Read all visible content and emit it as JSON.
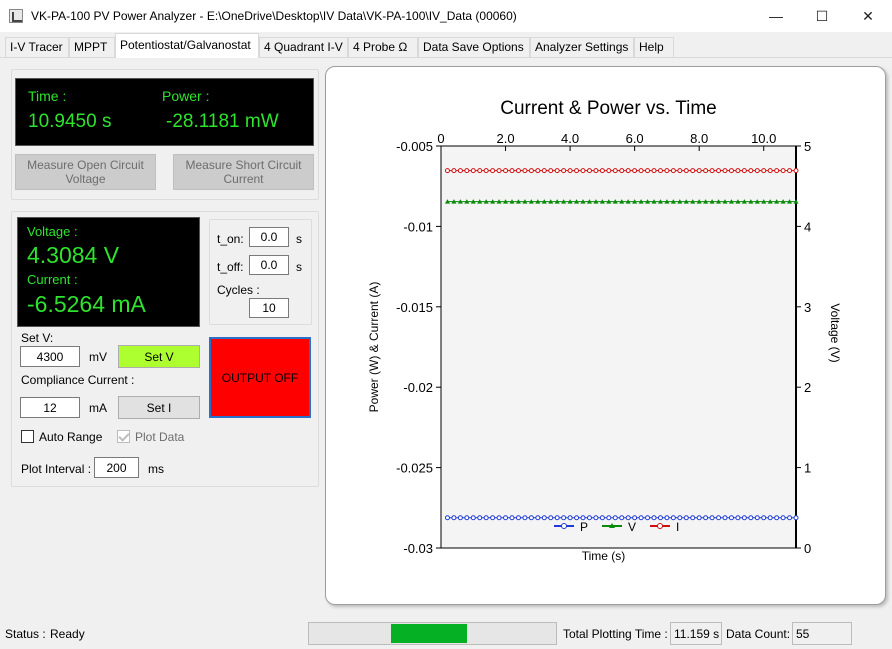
{
  "window": {
    "title": "VK-PA-100 PV Power Analyzer - E:\\OneDrive\\Desktop\\IV Data\\VK-PA-100\\IV_Data (00060)",
    "minimize_glyph": "—",
    "maximize_glyph": "☐",
    "close_glyph": "✕"
  },
  "tabs": [
    {
      "label": "I-V Tracer"
    },
    {
      "label": "MPPT"
    },
    {
      "label": "Potentiostat/Galvanostat"
    },
    {
      "label": "4 Quadrant I-V"
    },
    {
      "label": "4 Probe Ω"
    },
    {
      "label": "Data Save Options"
    },
    {
      "label": "Analyzer Settings"
    },
    {
      "label": "Help"
    }
  ],
  "readout": {
    "time_label": "Time :",
    "time_value": "10.9450 s",
    "power_label": "Power :",
    "power_value": "-28.1181 mW"
  },
  "buttons": {
    "measure_voc": "Measure Open Circuit Voltage",
    "measure_isc": "Measure Short Circuit Current",
    "set_v": "Set V",
    "set_i": "Set I",
    "output": "OUTPUT OFF"
  },
  "meter": {
    "voltage_label": "Voltage :",
    "voltage_value": "4.3084 V",
    "current_label": "Current :",
    "current_value": "-6.5264 mA"
  },
  "pulse": {
    "t_on_label": "t_on:",
    "t_on_value": "0.0",
    "t_on_unit": "s",
    "t_off_label": "t_off:",
    "t_off_value": "0.0",
    "t_off_unit": "s",
    "cycles_label": "Cycles :",
    "cycles_value": "10"
  },
  "setpoint": {
    "set_v_label": "Set V:",
    "set_v_value": "4300",
    "set_v_unit": "mV",
    "compliance_label": "Compliance Current :",
    "compliance_value": "12",
    "compliance_unit": "mA",
    "auto_range_label": "Auto Range",
    "auto_range_checked": false,
    "plot_data_label": "Plot Data",
    "plot_data_checked": true,
    "plot_interval_label": "Plot Interval :",
    "plot_interval_value": "200",
    "plot_interval_unit": "ms"
  },
  "status": {
    "status_label": "Status :",
    "status_value": "Ready",
    "progress_fraction": 0.51,
    "total_time_label": "Total Plotting Time :",
    "total_time_value": "11.159 s",
    "data_count_label": "Data Count:",
    "data_count_value": "55"
  },
  "colors": {
    "lcd_green": "#2ee32e",
    "set_v_button": "#adff2f",
    "output_off": "#ff0000",
    "progress": "#06b025",
    "series_p": "#1f3bd4",
    "series_v": "#0a8a0a",
    "series_i": "#d01010"
  },
  "chart_data": {
    "type": "line",
    "title": "Current & Power vs. Time",
    "xlabel": "Time (s)",
    "ylabel": "Power (W) & Current (A)",
    "y2label": "Voltage (V)",
    "xlim": [
      0,
      11
    ],
    "xticks": [
      "0",
      "2.0",
      "4.0",
      "6.0",
      "8.0",
      "10.0"
    ],
    "xtick_values": [
      0,
      2,
      4,
      6,
      8,
      10
    ],
    "ylim": [
      -0.03,
      -0.005
    ],
    "yticks": [
      "-0.005",
      "-0.01",
      "-0.015",
      "-0.02",
      "-0.025",
      "-0.03"
    ],
    "ytick_values": [
      -0.005,
      -0.01,
      -0.015,
      -0.02,
      -0.025,
      -0.03
    ],
    "y2lim": [
      0,
      5
    ],
    "y2ticks": [
      "5",
      "4",
      "3",
      "2",
      "1",
      "0"
    ],
    "y2tick_values": [
      5,
      4,
      3,
      2,
      1,
      0
    ],
    "x_axis_position": "top",
    "grid": false,
    "legend_position": "bottom-center",
    "x_start": 0.2,
    "x_step": 0.2,
    "num_points": 55,
    "series": [
      {
        "name": "P",
        "axis": "left",
        "value": -0.02812,
        "color": "#1f3bd4",
        "marker": "circle"
      },
      {
        "name": "V",
        "axis": "right",
        "value": 4.3084,
        "color": "#0a8a0a",
        "marker": "triangle"
      },
      {
        "name": "I",
        "axis": "left",
        "value": -0.00653,
        "color": "#d01010",
        "marker": "circle"
      }
    ]
  }
}
